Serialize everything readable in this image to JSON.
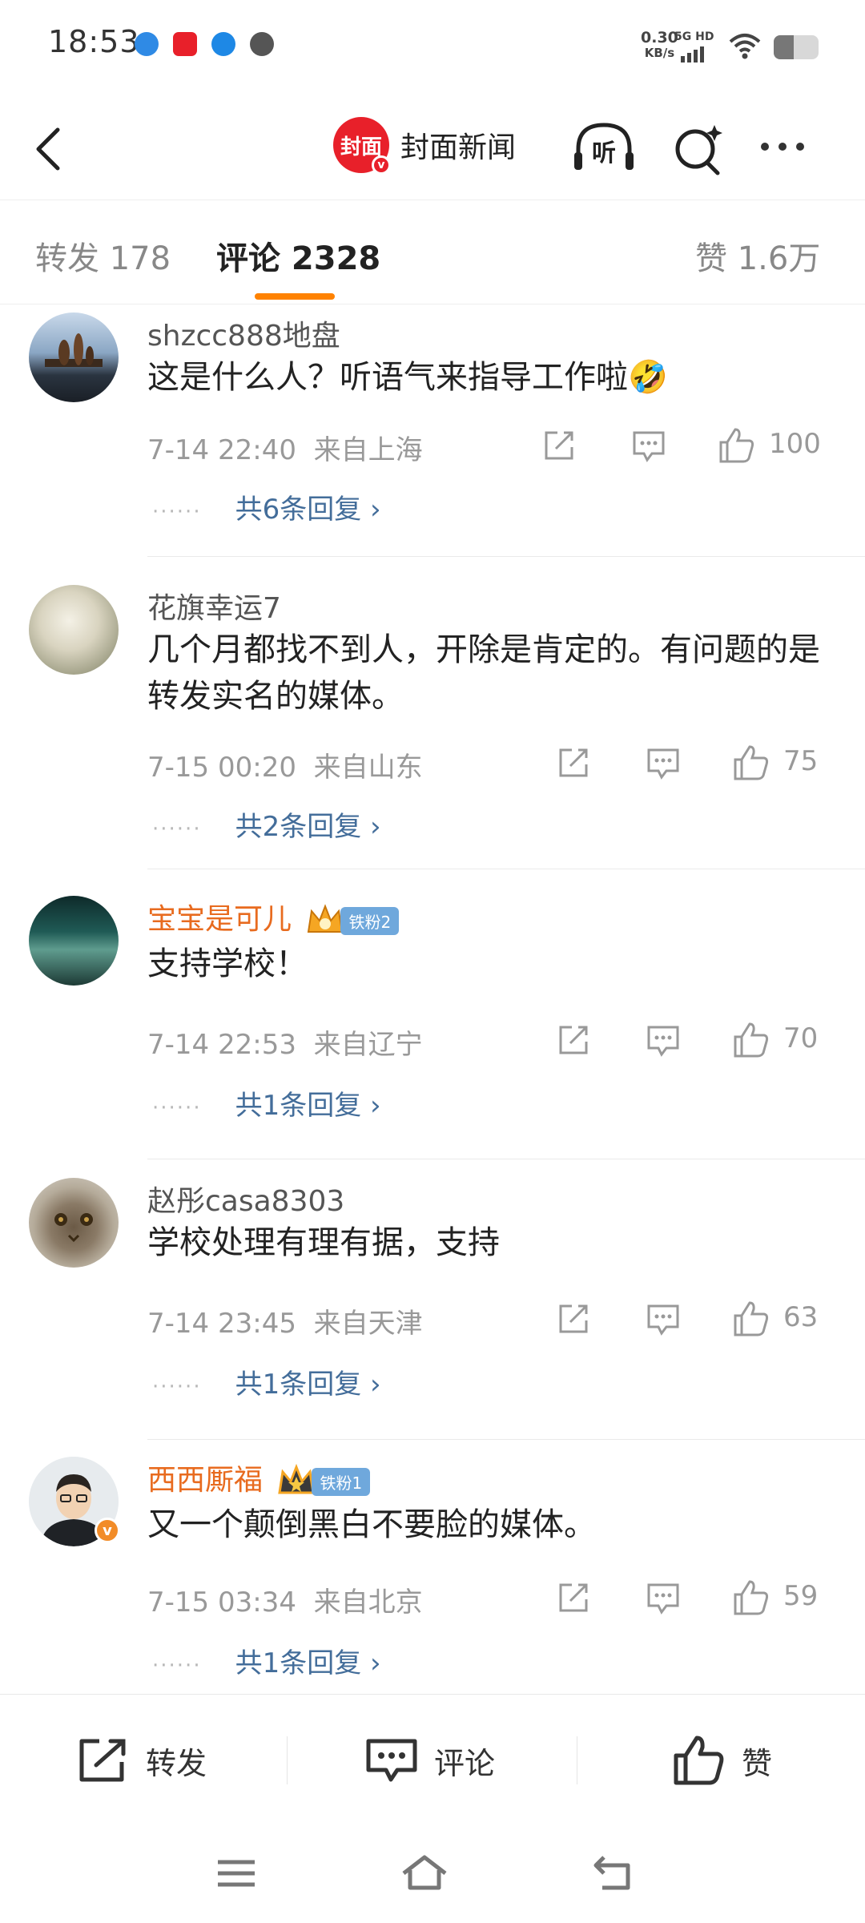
{
  "status_bar": {
    "time": "18:53",
    "speed_value": "0.30",
    "speed_unit": "KB/s",
    "network": "5G HD",
    "battery_level": 0.44
  },
  "header": {
    "brand_logo_text": "封面",
    "brand_name": "封面新闻",
    "listen_label": "听"
  },
  "tabs": {
    "forward": "转发 178",
    "comments": "评论 2328",
    "likes": "赞 1.6万"
  },
  "comments": [
    {
      "username": "shzcc888地盘",
      "text": "这是什么人？听语气来指导工作啦🤣",
      "time": "7-14 22:40",
      "location": "来自上海",
      "likes": "100",
      "replies": "共6条回复"
    },
    {
      "username": "花旗幸运7",
      "text": "几个月都找不到人，开除是肯定的。有问题的是转发实名的媒体。",
      "time": "7-15 00:20",
      "location": "来自山东",
      "likes": "75",
      "replies": "共2条回复"
    },
    {
      "username": "宝宝是可儿",
      "fan_badge": "铁粉2",
      "text": "支持学校！",
      "time": "7-14 22:53",
      "location": "来自辽宁",
      "likes": "70",
      "replies": "共1条回复"
    },
    {
      "username": "赵彤casa8303",
      "text": "学校处理有理有据，支持",
      "time": "7-14 23:45",
      "location": "来自天津",
      "likes": "63",
      "replies": "共1条回复"
    },
    {
      "username": "西西厮福",
      "fan_badge": "铁粉1",
      "text": "又一个颠倒黑白不要脸的媒体。",
      "time": "7-15 03:34",
      "location": "来自北京",
      "likes": "59",
      "replies": "共1条回复"
    }
  ],
  "bottom_bar": {
    "forward": "转发",
    "comment": "评论",
    "like": "赞"
  },
  "colors": {
    "accent": "#ff8200",
    "link": "#436d9a",
    "vip_name": "#e86b1f",
    "brand_red": "#e8202a"
  }
}
